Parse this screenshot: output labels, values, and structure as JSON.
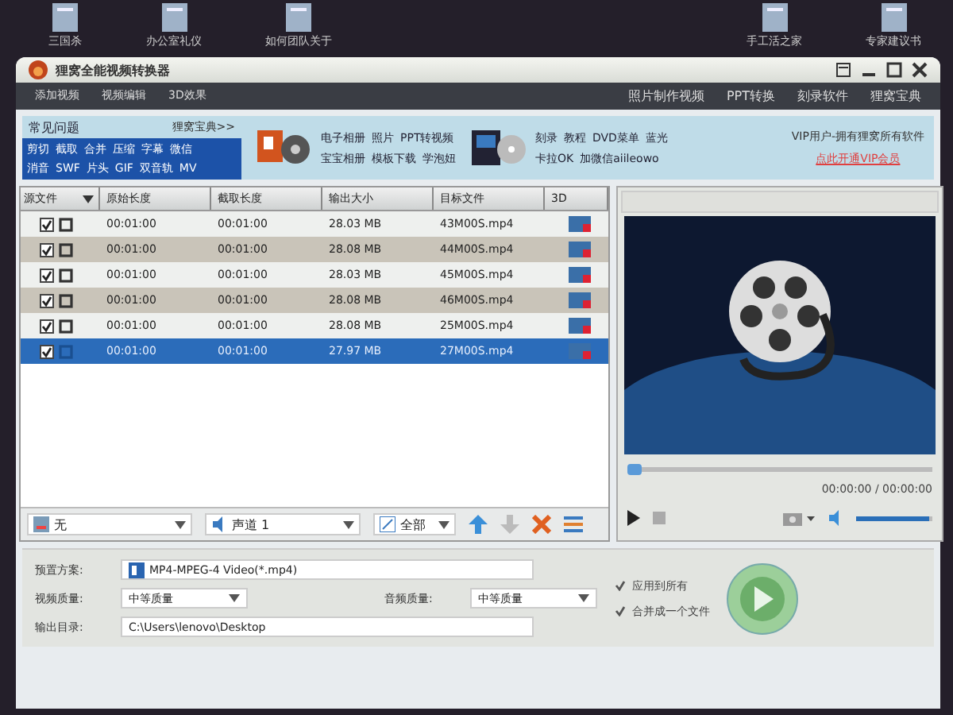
{
  "desktop_icons": [
    {
      "label": "三国杀"
    },
    {
      "label": "办公室礼仪"
    },
    {
      "label": "如何团队关于"
    },
    {
      "label": "手工活之家"
    },
    {
      "label": "专家建议书"
    }
  ],
  "window": {
    "title": "狸窝全能视频转换器"
  },
  "menu_left": [
    "添加视频",
    "视频编辑",
    "3D效果"
  ],
  "menu_right": [
    "照片制作视频",
    "PPT转换",
    "刻录软件",
    "狸窝宝典"
  ],
  "faq": {
    "title": "常见问题",
    "link": "狸窝宝典>>",
    "lines": [
      [
        "剪切",
        "截取",
        "合并",
        "压缩",
        "字幕",
        "微信"
      ],
      [
        "消音",
        "SWF",
        "片头",
        "GIF",
        "双音轨",
        "MV"
      ]
    ]
  },
  "promos": [
    {
      "kind": "ppt",
      "lines": [
        [
          "电子相册",
          "照片",
          "PPT转视频"
        ],
        [
          "宝宝相册",
          "模板下载",
          "学泡妞"
        ]
      ]
    },
    {
      "kind": "dvd",
      "lines": [
        [
          "刻录",
          "教程",
          "DVD菜单",
          "蓝光"
        ],
        [
          "卡拉OK",
          "加微信aiileowo"
        ]
      ]
    }
  ],
  "vip": {
    "text": "VIP用户-拥有狸窝所有软件",
    "link": "点此开通VIP会员"
  },
  "table": {
    "columns": [
      "源文件",
      "原始长度",
      "截取长度",
      "输出大小",
      "目标文件",
      "3D"
    ],
    "rows": [
      {
        "checked": true,
        "selected": false,
        "original": "00:01:00",
        "clip": "00:01:00",
        "size": "28.03 MB",
        "target": "43M00S.mp4"
      },
      {
        "checked": true,
        "selected": false,
        "original": "00:01:00",
        "clip": "00:01:00",
        "size": "28.08 MB",
        "target": "44M00S.mp4"
      },
      {
        "checked": true,
        "selected": false,
        "original": "00:01:00",
        "clip": "00:01:00",
        "size": "28.03 MB",
        "target": "45M00S.mp4"
      },
      {
        "checked": true,
        "selected": false,
        "original": "00:01:00",
        "clip": "00:01:00",
        "size": "28.08 MB",
        "target": "46M00S.mp4"
      },
      {
        "checked": true,
        "selected": false,
        "original": "00:01:00",
        "clip": "00:01:00",
        "size": "28.08 MB",
        "target": "25M00S.mp4"
      },
      {
        "checked": true,
        "selected": true,
        "original": "00:01:00",
        "clip": "00:01:00",
        "size": "27.97 MB",
        "target": "27M00S.mp4"
      }
    ]
  },
  "preview": {
    "time": "00:00:00 / 00:00:00",
    "seek": {
      "level": 0
    },
    "volume": {
      "level": 0.95
    }
  },
  "toolbar": {
    "subtitle": "无",
    "audio": "声道 1",
    "filter": "全部"
  },
  "settings": {
    "preset_label": "预置方案:",
    "preset": "MP4-MPEG-4 Video(*.mp4)",
    "video_label": "视频质量:",
    "video": "中等质量",
    "audio_label": "音频质量:",
    "audio": "中等质量",
    "output_label": "输出目录:",
    "output": "C:\\Users\\lenovo\\Desktop"
  },
  "options": [
    {
      "label": "应用到所有",
      "checked": true
    },
    {
      "label": "合并成一个文件",
      "checked": true
    }
  ]
}
